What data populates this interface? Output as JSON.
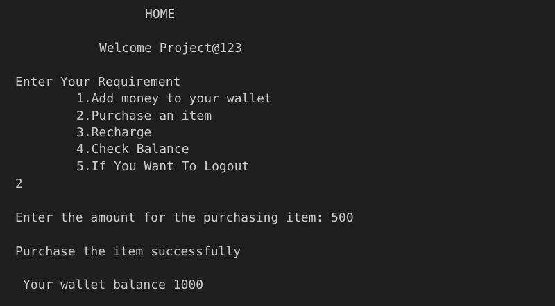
{
  "screen": {
    "title": "HOME",
    "welcome": "Welcome Project@123",
    "requirement_prompt": "Enter Your Requirement",
    "menu_options": [
      "1.Add money to your wallet",
      "2.Purchase an item",
      "3.Recharge",
      "4.Check Balance",
      "5.If You Want To Logout"
    ],
    "user_choice": "2",
    "amount_line": "Enter the amount for the purchasing item: 500",
    "success_message": "Purchase the item successfully",
    "balance_line": "Your wallet balance 1000"
  },
  "colors": {
    "background": "#1e1e1e",
    "text": "#cccccc"
  }
}
